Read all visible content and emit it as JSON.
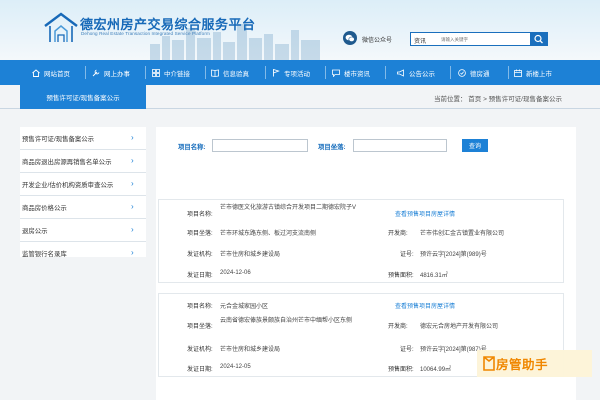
{
  "header": {
    "title": "德宏州房产交易综合服务平台",
    "subtitle": "Dehong Real Estate Transaction Integrated Service Platform",
    "wechat_label": "微信公众号",
    "search": {
      "category": "资讯",
      "placeholder": "请输入关键字"
    }
  },
  "nav": {
    "items": [
      {
        "label": "网站首页",
        "icon": "home-icon"
      },
      {
        "label": "网上办事",
        "icon": "tool-icon"
      },
      {
        "label": "中介链接",
        "icon": "grid-icon"
      },
      {
        "label": "信息验真",
        "icon": "book-icon"
      },
      {
        "label": "专项活动",
        "icon": "flag-icon"
      },
      {
        "label": "楼市资讯",
        "icon": "chat-icon"
      },
      {
        "label": "公告公示",
        "icon": "megaphone-icon"
      },
      {
        "label": "德房通",
        "icon": "badge-icon"
      },
      {
        "label": "新楼上市",
        "icon": "calendar-icon"
      }
    ]
  },
  "breadcrumb": {
    "section": "预售许可证/现售备案公示",
    "path": "当前位置： 首页 > 预售许可证/现售备案公示"
  },
  "sidebar": {
    "items": [
      {
        "label": "预售许可证/现售备案公示"
      },
      {
        "label": "商品房退出房源再销售名单公示"
      },
      {
        "label": "开发企业/估价机构资质审查公示"
      },
      {
        "label": "商品房价格公示"
      },
      {
        "label": "退房公示"
      },
      {
        "label": "监管银行名录库"
      }
    ]
  },
  "filter": {
    "name_label": "项目名称:",
    "location_label": "项目坐落:",
    "query_button": "查询"
  },
  "records": [
    {
      "name_key": "项目名称:",
      "name": "芒市德医文化旅游古镇综合开发项目二期德宏院子V",
      "detail_link": "查看预售项目房屋详情",
      "location_key": "项目坐落:",
      "location": "芒市环城东路东侧、板过河支流南侧",
      "developer_key": "开发商:",
      "developer": "芒市伟创汇金古镇置业有限公司",
      "issuer_key": "发证机构:",
      "issuer": "芒市住房和城乡建设局",
      "cert_key": "证号:",
      "cert": "预许云字[2024]第(989)号",
      "date_key": "发证日期:",
      "date": "2024-12-06",
      "area_key": "预售面积:",
      "area": "4816.31㎡"
    },
    {
      "name_key": "项目名称:",
      "name": "元合金城家园小区",
      "detail_link": "查看预售项目房屋详情",
      "location_key": "项目坐落:",
      "location": "云南省德宏傣族景颇族自治州芒市中缅帮小区东侧",
      "developer_key": "开发商:",
      "developer": "德宏元合房地产开发有限公司",
      "issuer_key": "发证机构:",
      "issuer": "芒市住房和城乡建设局",
      "cert_key": "证号:",
      "cert": "预许云字[2024]第(987)号",
      "date_key": "发证日期:",
      "date": "2024-12-05",
      "area_key": "预售面积:",
      "area": "10064.99㎡"
    }
  ],
  "watermark": {
    "text": "房管助手"
  },
  "colors": {
    "primary": "#1d81d6",
    "title": "#1769b8",
    "watermark": "#f08700"
  }
}
